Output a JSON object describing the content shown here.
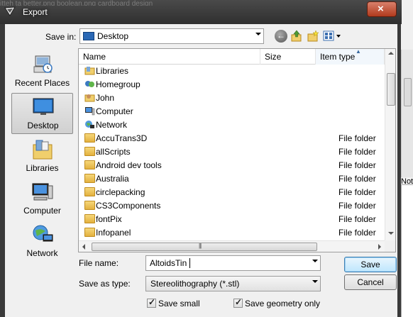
{
  "window": {
    "title": "Export",
    "background_tabs": "itteh ta better.png    boolean.png    cardboard design    "
  },
  "toolbar": {
    "save_in_label": "Save in:",
    "location": "Desktop"
  },
  "places": [
    {
      "label": "Recent Places",
      "icon": "recent-places-icon",
      "selected": false
    },
    {
      "label": "Desktop",
      "icon": "desktop-icon",
      "selected": true
    },
    {
      "label": "Libraries",
      "icon": "libraries-icon",
      "selected": false
    },
    {
      "label": "Computer",
      "icon": "computer-icon",
      "selected": false
    },
    {
      "label": "Network",
      "icon": "network-icon",
      "selected": false
    }
  ],
  "list": {
    "columns": {
      "name": "Name",
      "size": "Size",
      "type": "Item type"
    },
    "rows": [
      {
        "name": "Libraries",
        "type": "",
        "icon": "libraries-icon"
      },
      {
        "name": "Homegroup",
        "type": "",
        "icon": "homegroup-icon"
      },
      {
        "name": "John",
        "type": "",
        "icon": "user-folder-icon"
      },
      {
        "name": "Computer",
        "type": "",
        "icon": "computer-icon"
      },
      {
        "name": "Network",
        "type": "",
        "icon": "network-icon"
      },
      {
        "name": "AccuTrans3D",
        "type": "File folder",
        "icon": "folder-icon"
      },
      {
        "name": "allScripts",
        "type": "File folder",
        "icon": "folder-icon"
      },
      {
        "name": "Android dev tools",
        "type": "File folder",
        "icon": "folder-icon"
      },
      {
        "name": "Australia",
        "type": "File folder",
        "icon": "folder-icon"
      },
      {
        "name": "circlepacking",
        "type": "File folder",
        "icon": "folder-icon"
      },
      {
        "name": "CS3Components",
        "type": "File folder",
        "icon": "folder-icon"
      },
      {
        "name": "fontPix",
        "type": "File folder",
        "icon": "folder-icon"
      },
      {
        "name": "Infopanel",
        "type": "File folder",
        "icon": "folder-icon"
      }
    ]
  },
  "form": {
    "file_name_label": "File name:",
    "file_name_value": "AltoidsTin",
    "save_as_type_label": "Save as type:",
    "save_as_type_value": "Stereolithography (*.stl)",
    "save_button": "Save",
    "cancel_button": "Cancel",
    "save_small_label": "Save small",
    "save_small_checked": true,
    "save_geometry_label": "Save geometry only",
    "save_geometry_checked": true
  },
  "side_note": "Not"
}
